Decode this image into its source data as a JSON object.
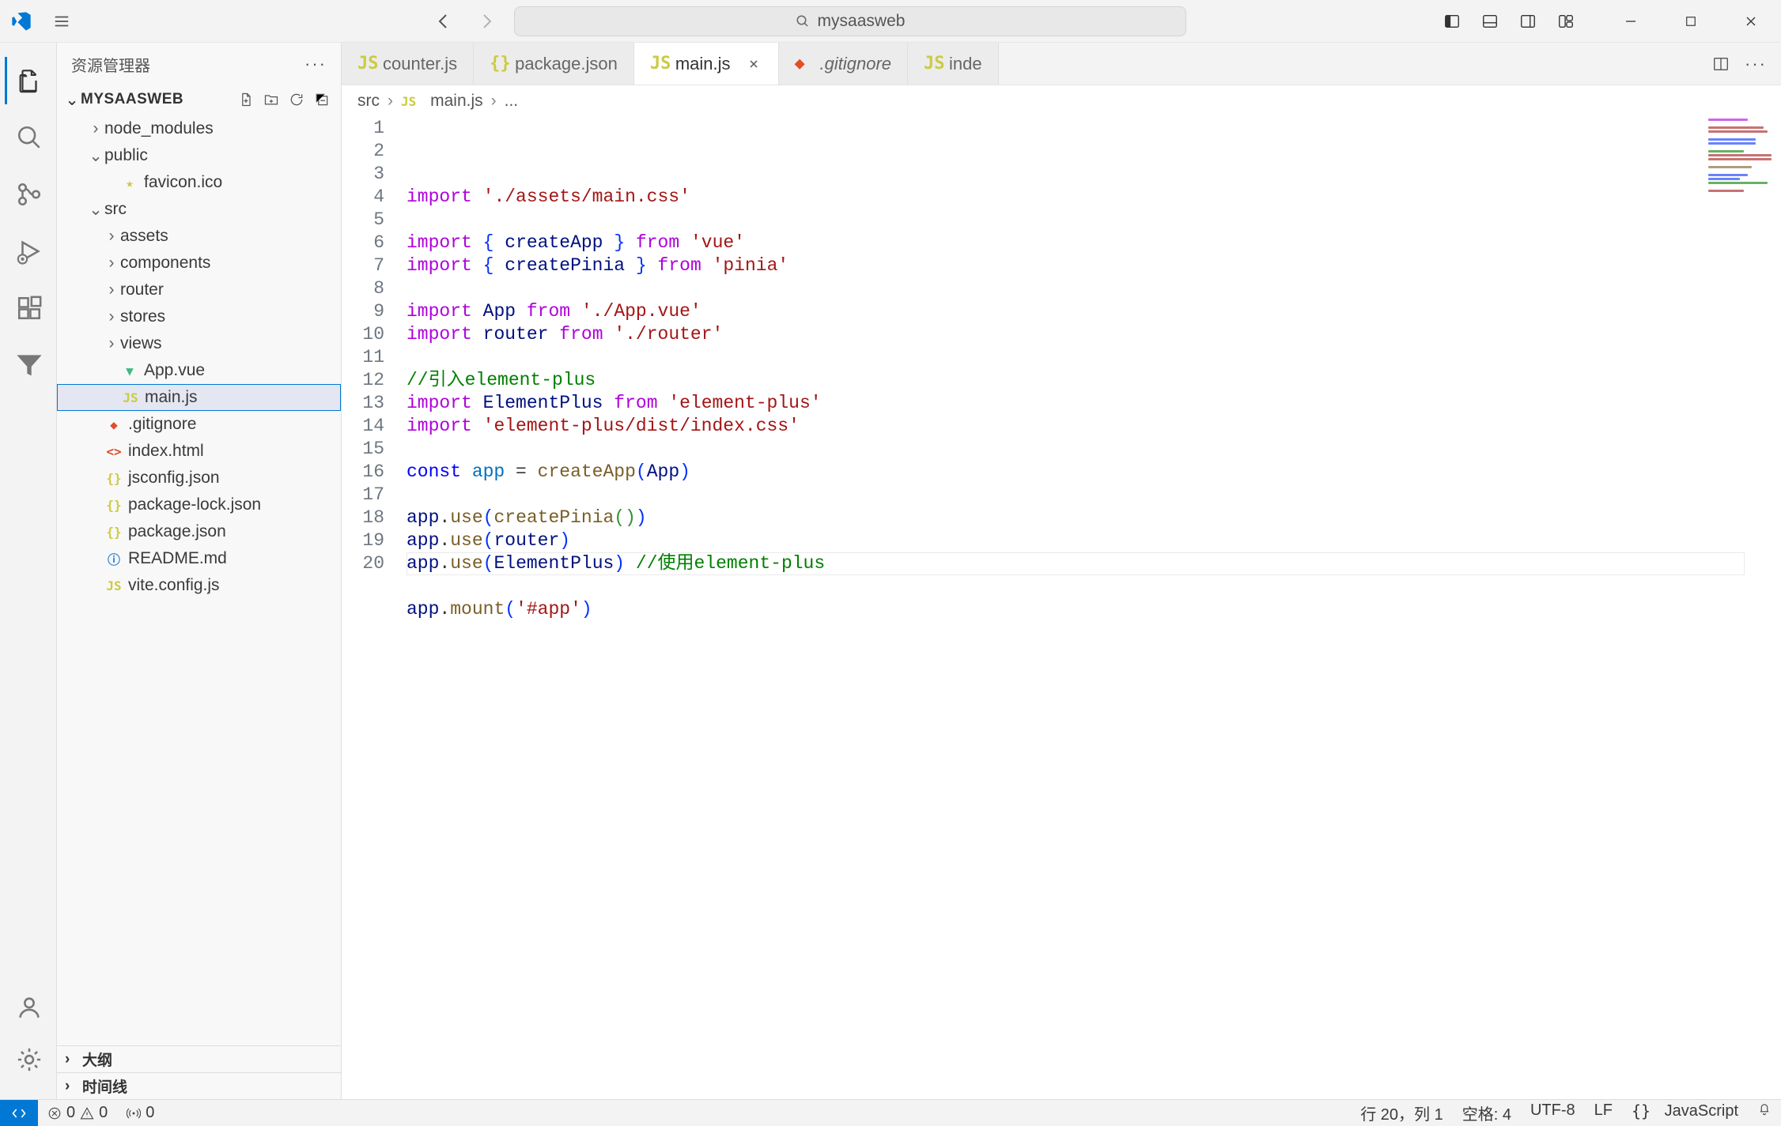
{
  "titlebar": {
    "search_text": "mysaasweb"
  },
  "sidebar": {
    "title": "资源管理器",
    "project": "MYSAASWEB",
    "items": [
      {
        "label": "node_modules",
        "indent": "pad2",
        "twisty": "›",
        "icon": "",
        "icClass": ""
      },
      {
        "label": "public",
        "indent": "pad2",
        "twisty": "⌄",
        "icon": "",
        "icClass": ""
      },
      {
        "label": "favicon.ico",
        "indent": "pad3",
        "twisty": "",
        "icon": "★",
        "icClass": "ic-star"
      },
      {
        "label": "src",
        "indent": "pad2",
        "twisty": "⌄",
        "icon": "",
        "icClass": ""
      },
      {
        "label": "assets",
        "indent": "pad3",
        "twisty": "›",
        "icon": "",
        "icClass": ""
      },
      {
        "label": "components",
        "indent": "pad3",
        "twisty": "›",
        "icon": "",
        "icClass": ""
      },
      {
        "label": "router",
        "indent": "pad3",
        "twisty": "›",
        "icon": "",
        "icClass": ""
      },
      {
        "label": "stores",
        "indent": "pad3",
        "twisty": "›",
        "icon": "",
        "icClass": ""
      },
      {
        "label": "views",
        "indent": "pad3",
        "twisty": "›",
        "icon": "",
        "icClass": ""
      },
      {
        "label": "App.vue",
        "indent": "pad3",
        "twisty": "",
        "icon": "▼",
        "icClass": "ic-vue"
      },
      {
        "label": "main.js",
        "indent": "pad3",
        "twisty": "",
        "icon": "JS",
        "icClass": "ic-js",
        "selected": true
      },
      {
        "label": ".gitignore",
        "indent": "pad2",
        "twisty": "",
        "icon": "◆",
        "icClass": "ic-git"
      },
      {
        "label": "index.html",
        "indent": "pad2",
        "twisty": "",
        "icon": "<>",
        "icClass": "ic-html"
      },
      {
        "label": "jsconfig.json",
        "indent": "pad2",
        "twisty": "",
        "icon": "{}",
        "icClass": "ic-json"
      },
      {
        "label": "package-lock.json",
        "indent": "pad2",
        "twisty": "",
        "icon": "{}",
        "icClass": "ic-json"
      },
      {
        "label": "package.json",
        "indent": "pad2",
        "twisty": "",
        "icon": "{}",
        "icClass": "ic-json"
      },
      {
        "label": "README.md",
        "indent": "pad2",
        "twisty": "",
        "icon": "ⓘ",
        "icClass": "ic-info"
      },
      {
        "label": "vite.config.js",
        "indent": "pad2",
        "twisty": "",
        "icon": "JS",
        "icClass": "ic-js"
      }
    ],
    "outline": "大纲",
    "timeline": "时间线"
  },
  "tabs": [
    {
      "label": "counter.js",
      "icon": "JS",
      "icClass": "ic-js",
      "active": false,
      "close": false
    },
    {
      "label": "package.json",
      "icon": "{}",
      "icClass": "ic-json",
      "active": false,
      "close": false
    },
    {
      "label": "main.js",
      "icon": "JS",
      "icClass": "ic-js",
      "active": true,
      "close": true
    },
    {
      "label": ".gitignore",
      "icon": "◆",
      "icClass": "ic-git",
      "italic": true,
      "active": false,
      "close": false
    },
    {
      "label": "inde",
      "icon": "JS",
      "icClass": "ic-js",
      "active": false,
      "close": false
    }
  ],
  "breadcrumb": {
    "src": "src",
    "file": "main.js",
    "tail": "..."
  },
  "code": {
    "lines": [
      {
        "tokens": [
          [
            "kw",
            "import"
          ],
          [
            "",
            " "
          ],
          [
            "str",
            "'./assets/main.css'"
          ]
        ]
      },
      {
        "tokens": []
      },
      {
        "tokens": [
          [
            "kw",
            "import"
          ],
          [
            "",
            " "
          ],
          [
            "br",
            "{"
          ],
          [
            "",
            " "
          ],
          [
            "id",
            "createApp"
          ],
          [
            "",
            " "
          ],
          [
            "br",
            "}"
          ],
          [
            "",
            " "
          ],
          [
            "kw",
            "from"
          ],
          [
            "",
            " "
          ],
          [
            "str",
            "'vue'"
          ]
        ]
      },
      {
        "tokens": [
          [
            "kw",
            "import"
          ],
          [
            "",
            " "
          ],
          [
            "br",
            "{"
          ],
          [
            "",
            " "
          ],
          [
            "id",
            "createPinia"
          ],
          [
            "",
            " "
          ],
          [
            "br",
            "}"
          ],
          [
            "",
            " "
          ],
          [
            "kw",
            "from"
          ],
          [
            "",
            " "
          ],
          [
            "str",
            "'pinia'"
          ]
        ]
      },
      {
        "tokens": []
      },
      {
        "tokens": [
          [
            "kw",
            "import"
          ],
          [
            "",
            " "
          ],
          [
            "id",
            "App"
          ],
          [
            "",
            " "
          ],
          [
            "kw",
            "from"
          ],
          [
            "",
            " "
          ],
          [
            "str",
            "'./App.vue'"
          ]
        ]
      },
      {
        "tokens": [
          [
            "kw",
            "import"
          ],
          [
            "",
            " "
          ],
          [
            "id",
            "router"
          ],
          [
            "",
            " "
          ],
          [
            "kw",
            "from"
          ],
          [
            "",
            " "
          ],
          [
            "str",
            "'./router'"
          ]
        ]
      },
      {
        "tokens": []
      },
      {
        "tokens": [
          [
            "cm",
            "//引入element-plus"
          ]
        ]
      },
      {
        "tokens": [
          [
            "kw",
            "import"
          ],
          [
            "",
            " "
          ],
          [
            "id",
            "ElementPlus"
          ],
          [
            "",
            " "
          ],
          [
            "kw",
            "from"
          ],
          [
            "",
            " "
          ],
          [
            "str",
            "'element-plus'"
          ]
        ]
      },
      {
        "tokens": [
          [
            "kw",
            "import"
          ],
          [
            "",
            " "
          ],
          [
            "str",
            "'element-plus/dist/index.css'"
          ]
        ]
      },
      {
        "tokens": []
      },
      {
        "tokens": [
          [
            "kw2",
            "const"
          ],
          [
            "",
            " "
          ],
          [
            "var",
            "app"
          ],
          [
            "",
            " = "
          ],
          [
            "fn",
            "createApp"
          ],
          [
            "br",
            "("
          ],
          [
            "id",
            "App"
          ],
          [
            "br",
            ")"
          ]
        ]
      },
      {
        "tokens": []
      },
      {
        "tokens": [
          [
            "id",
            "app"
          ],
          [
            "",
            ". "
          ],
          [
            "fn",
            "use"
          ],
          [
            "br",
            "("
          ],
          [
            "fn",
            "createPinia"
          ],
          [
            "br2",
            "("
          ],
          [
            "br2",
            ")"
          ],
          [
            "br",
            ")"
          ]
        ]
      },
      {
        "tokens": [
          [
            "id",
            "app"
          ],
          [
            "",
            ". "
          ],
          [
            "fn",
            "use"
          ],
          [
            "br",
            "("
          ],
          [
            "id",
            "router"
          ],
          [
            "br",
            ")"
          ]
        ]
      },
      {
        "tokens": [
          [
            "id",
            "app"
          ],
          [
            "",
            ". "
          ],
          [
            "fn",
            "use"
          ],
          [
            "br",
            "("
          ],
          [
            "id",
            "ElementPlus"
          ],
          [
            "br",
            ")"
          ],
          [
            "",
            " "
          ],
          [
            "cm",
            "//使用element-plus"
          ]
        ]
      },
      {
        "tokens": []
      },
      {
        "tokens": [
          [
            "id",
            "app"
          ],
          [
            "",
            ". "
          ],
          [
            "fn",
            "mount"
          ],
          [
            "br",
            "("
          ],
          [
            "str",
            "'#app'"
          ],
          [
            "br",
            ")"
          ]
        ]
      },
      {
        "tokens": []
      }
    ]
  },
  "status": {
    "errors": "0",
    "warnings": "0",
    "ports": "0",
    "cursor": "行 20，列 1",
    "indent": "空格: 4",
    "encoding": "UTF-8",
    "eol": "LF",
    "lang": "JavaScript"
  }
}
